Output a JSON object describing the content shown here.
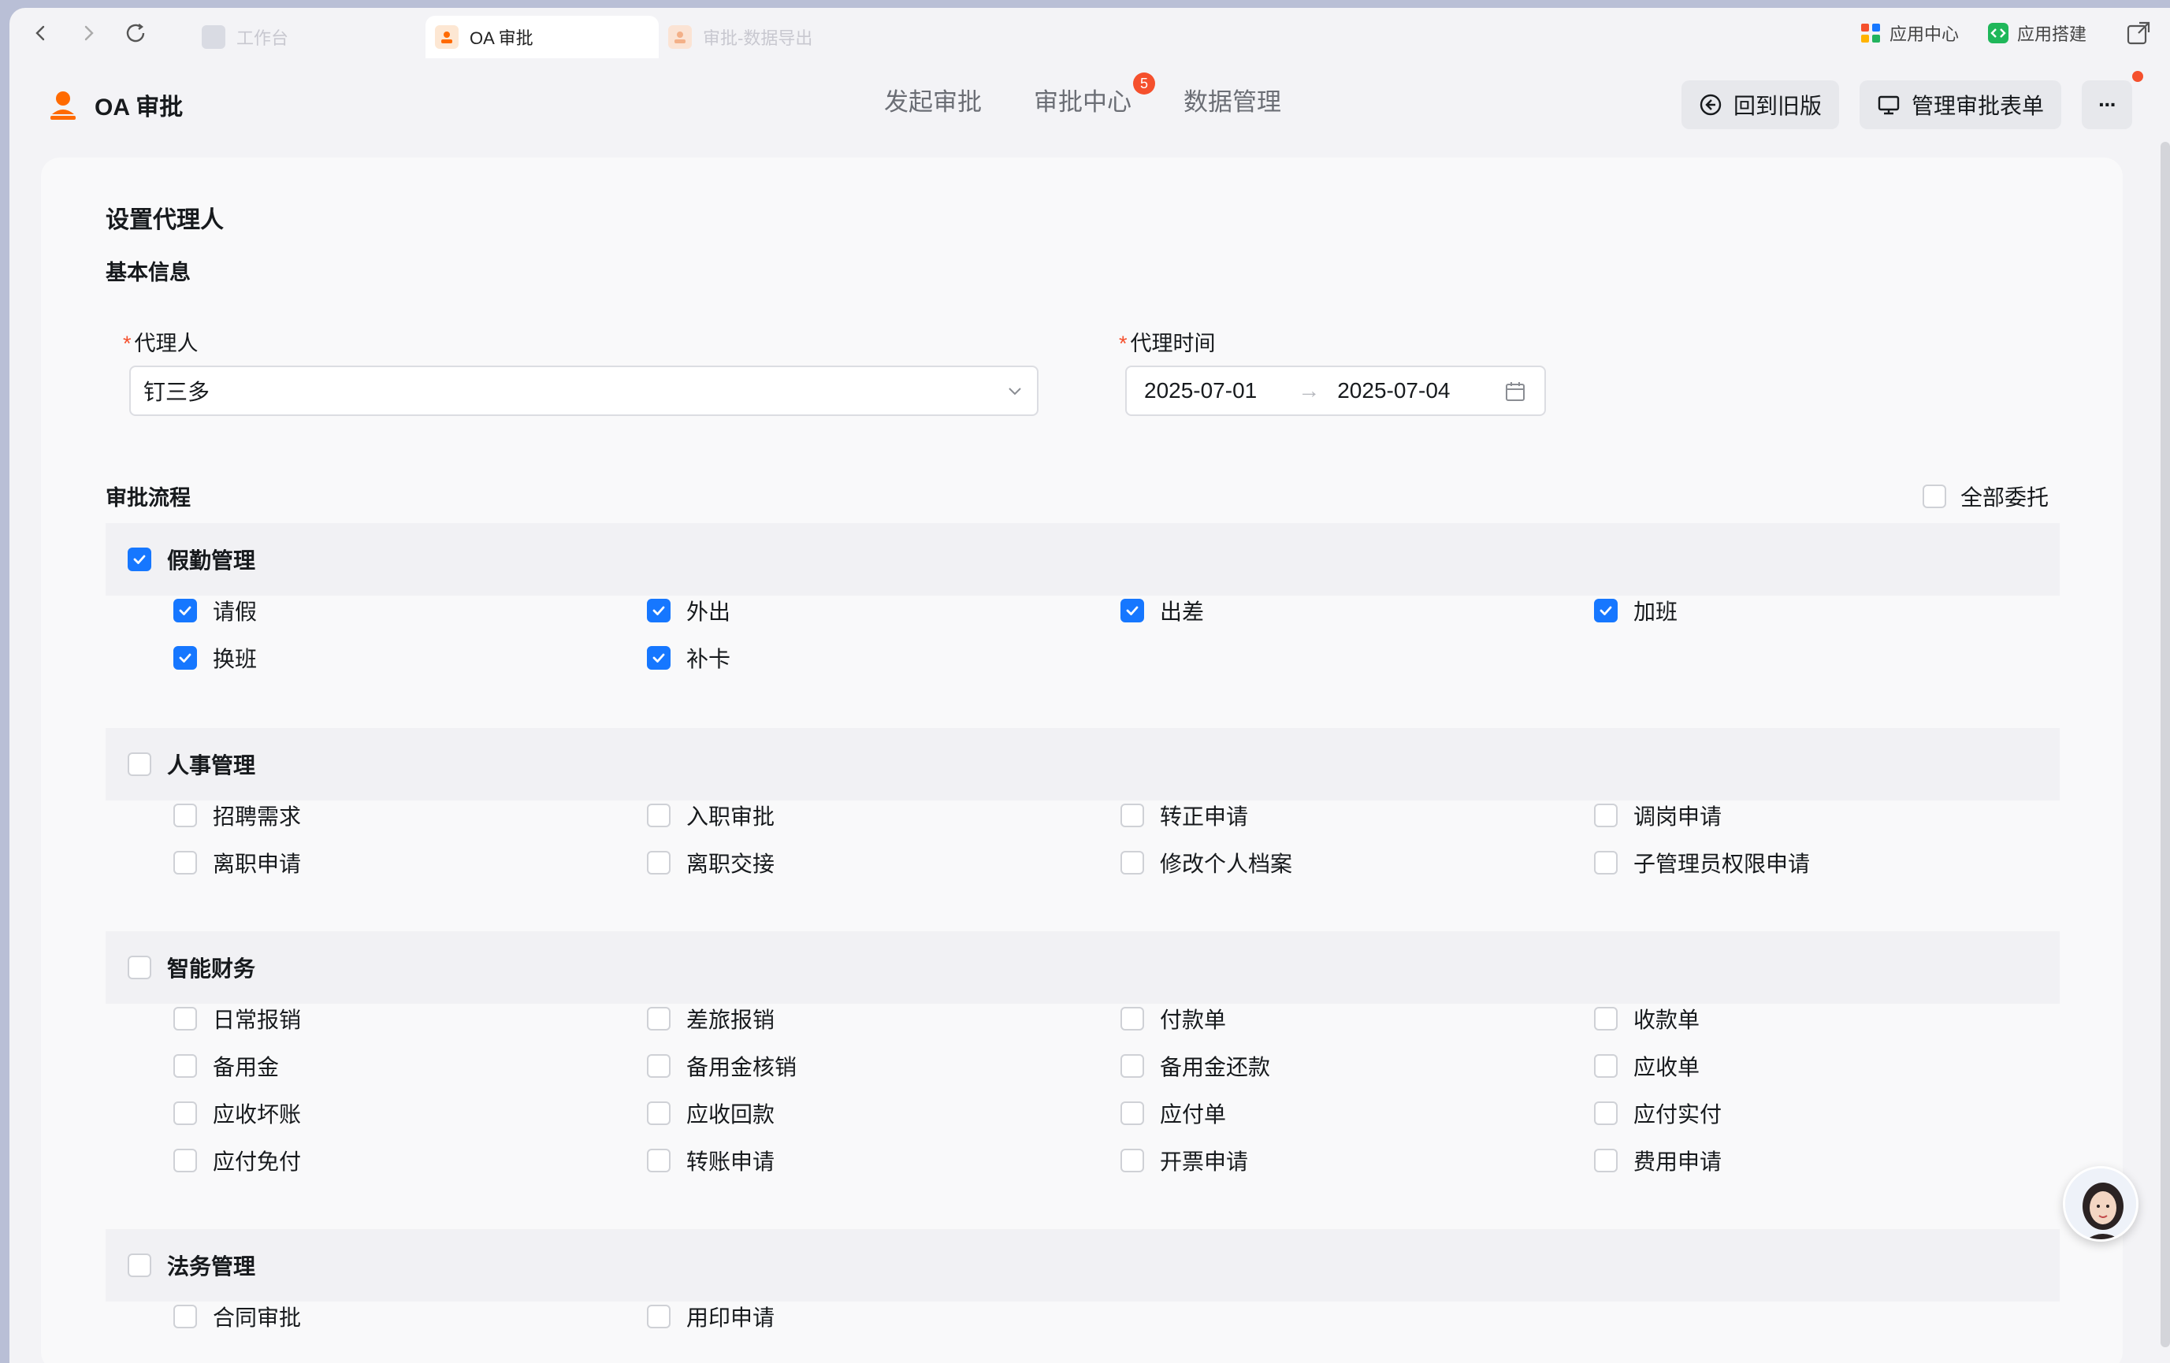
{
  "tabs": [
    {
      "label": "工作台",
      "icon": "workbench-icon"
    },
    {
      "label": "OA 审批",
      "icon": "oa-approval-icon"
    },
    {
      "label": "审批-数据导出",
      "icon": "oa-approval-icon"
    }
  ],
  "tabbar_right": {
    "app_center": "应用中心",
    "app_builder": "应用搭建"
  },
  "app": {
    "title": "OA 审批"
  },
  "topnav": [
    {
      "label": "发起审批"
    },
    {
      "label": "审批中心",
      "badge": "5"
    },
    {
      "label": "数据管理"
    }
  ],
  "actions": {
    "back_old": "回到旧版",
    "manage_forms": "管理审批表单",
    "more": "···"
  },
  "page": {
    "title": "设置代理人",
    "section_basic": "基本信息",
    "agent_label": "代理人",
    "agent_value": "钉三多",
    "time_label": "代理时间",
    "date_start": "2025-07-01",
    "date_end": "2025-07-04",
    "range_arrow": "→",
    "required_mark": "*",
    "section_flow": "审批流程",
    "delegate_all": "全部委托"
  },
  "groups": [
    {
      "name": "假勤管理",
      "checked": true,
      "items": [
        {
          "label": "请假",
          "checked": true
        },
        {
          "label": "外出",
          "checked": true
        },
        {
          "label": "出差",
          "checked": true
        },
        {
          "label": "加班",
          "checked": true
        },
        {
          "label": "换班",
          "checked": true
        },
        {
          "label": "补卡",
          "checked": true
        }
      ]
    },
    {
      "name": "人事管理",
      "checked": false,
      "items": [
        {
          "label": "招聘需求",
          "checked": false
        },
        {
          "label": "入职审批",
          "checked": false
        },
        {
          "label": "转正申请",
          "checked": false
        },
        {
          "label": "调岗申请",
          "checked": false
        },
        {
          "label": "离职申请",
          "checked": false
        },
        {
          "label": "离职交接",
          "checked": false
        },
        {
          "label": "修改个人档案",
          "checked": false
        },
        {
          "label": "子管理员权限申请",
          "checked": false
        }
      ]
    },
    {
      "name": "智能财务",
      "checked": false,
      "items": [
        {
          "label": "日常报销",
          "checked": false
        },
        {
          "label": "差旅报销",
          "checked": false
        },
        {
          "label": "付款单",
          "checked": false
        },
        {
          "label": "收款单",
          "checked": false
        },
        {
          "label": "备用金",
          "checked": false
        },
        {
          "label": "备用金核销",
          "checked": false
        },
        {
          "label": "备用金还款",
          "checked": false
        },
        {
          "label": "应收单",
          "checked": false
        },
        {
          "label": "应收坏账",
          "checked": false
        },
        {
          "label": "应收回款",
          "checked": false
        },
        {
          "label": "应付单",
          "checked": false
        },
        {
          "label": "应付实付",
          "checked": false
        },
        {
          "label": "应付免付",
          "checked": false
        },
        {
          "label": "转账申请",
          "checked": false
        },
        {
          "label": "开票申请",
          "checked": false
        },
        {
          "label": "费用申请",
          "checked": false
        }
      ]
    },
    {
      "name": "法务管理",
      "checked": false,
      "items": [
        {
          "label": "合同审批",
          "checked": false
        },
        {
          "label": "用印申请",
          "checked": false
        }
      ]
    }
  ],
  "colors": {
    "accent": "#1677ff",
    "badge": "#f5502d",
    "brand": "#ff6a00"
  }
}
